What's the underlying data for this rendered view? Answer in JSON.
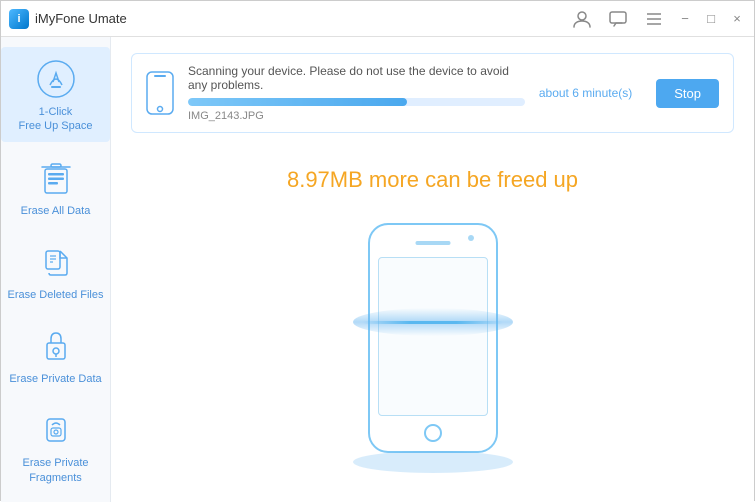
{
  "app": {
    "title": "iMyFone Umate",
    "logo_letter": "i"
  },
  "titlebar": {
    "chat_icon": "💬",
    "menu_icon": "≡",
    "minimize_icon": "−",
    "maximize_icon": "□",
    "close_icon": "×",
    "user_icon": "👤"
  },
  "sidebar": {
    "items": [
      {
        "id": "free-up-space",
        "label": "1-Click\nFree Up Space",
        "active": true
      },
      {
        "id": "erase-all-data",
        "label": "Erase All Data",
        "active": false
      },
      {
        "id": "erase-deleted-files",
        "label": "Erase Deleted Files",
        "active": false
      },
      {
        "id": "erase-private-data",
        "label": "Erase Private Data",
        "active": false
      },
      {
        "id": "erase-private-fragments",
        "label": "Erase Private Fragments",
        "active": false
      }
    ]
  },
  "scan": {
    "message": "Scanning your device. Please do not use the device to avoid any problems.",
    "time_remaining": "about 6 minute(s)",
    "filename": "IMG_2143.JPG",
    "progress_percent": 65,
    "stop_label": "Stop"
  },
  "main": {
    "freed_text": "8.97MB more can be freed up"
  }
}
